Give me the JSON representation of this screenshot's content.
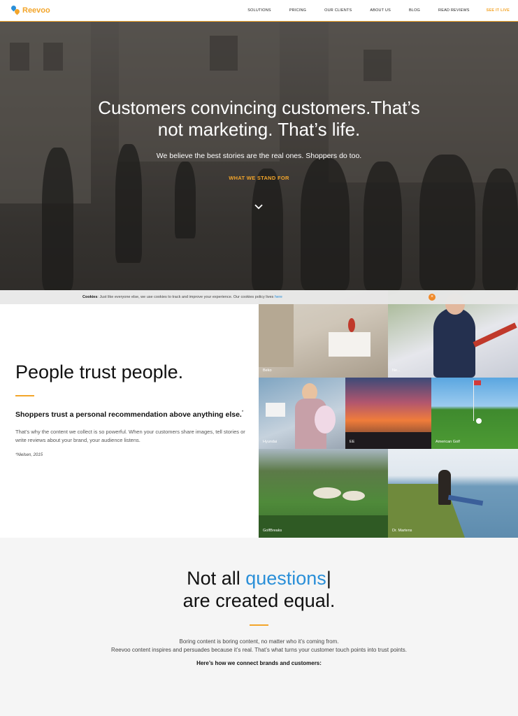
{
  "nav": {
    "logo_text": "Reevoo",
    "links": [
      "SOLUTIONS",
      "PRICING",
      "OUR CLIENTS",
      "ABOUT US",
      "BLOG",
      "READ REVIEWS"
    ],
    "see_it_live": "SEE IT LIVE"
  },
  "hero": {
    "title_line1": "Customers convincing customers.That’s",
    "title_line2": "not marketing. That’s life.",
    "subtitle": "We believe the best stories are the real ones. Shoppers do too.",
    "cta": "WHAT WE STAND FOR",
    "scroll_icon": "chevron-down-icon"
  },
  "cookies": {
    "label": "Cookies",
    "text": ": Just like everyone else, we use cookies to track and improve your experience. Our cookies policy lives ",
    "link": "here",
    "close_icon": "close-icon"
  },
  "trust": {
    "title": "People trust people.",
    "subtitle": "Shoppers trust a personal recommendation above anything else.",
    "subtitle_mark": "*",
    "body": "That’s why the content we collect is so powerful. When your customers share images, tell stories or write reviews about your brand, your audience listens.",
    "note": "*Nielsen, 2015",
    "tiles": [
      {
        "caption": "Beko"
      },
      {
        "caption": "Ne..."
      },
      {
        "caption": "Hyundai"
      },
      {
        "caption": "EE"
      },
      {
        "caption": "American Golf"
      },
      {
        "caption": "GolfBreaks"
      },
      {
        "caption": "Dr. Martens"
      }
    ]
  },
  "questions": {
    "title_pre": "Not all ",
    "title_highlight": "questions",
    "title_cursor": "|",
    "title_line2": "are created equal.",
    "body_line1": "Boring content is boring content, no matter who it’s coming from.",
    "body_line2": "Reevoo content inspires and persuades because it’s real. That’s what turns your customer touch points into trust points.",
    "lead": "Here’s how we connect brands and customers:"
  },
  "colors": {
    "accent": "#f3a52a",
    "link": "#2a8fd8"
  }
}
